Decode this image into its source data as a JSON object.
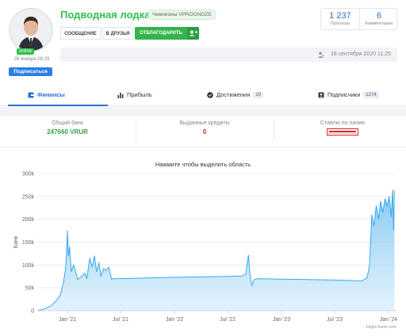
{
  "profile": {
    "name": "Подводная лодка",
    "badge": "Чемпионы VPROGNOZE",
    "status": "online",
    "joined": "28 января 08:29",
    "subscribe_label": "Подписаться"
  },
  "actions": {
    "message_label": "СООБЩЕНИЕ",
    "friend_label": "В ДРУЗЬЯ",
    "thank_label": "ОТБЛАГОДАРИТЬ"
  },
  "stats": {
    "forecasts_value": "1 237",
    "forecasts_label": "Прогнозы",
    "comments_value": "6",
    "comments_label": "Комментарии"
  },
  "last_visit": "18 сентября 2020 11:25",
  "tabs": [
    {
      "label": "Финансы",
      "icon": "wallet-icon",
      "active": true
    },
    {
      "label": "Прибыль",
      "icon": "bar-chart-icon"
    },
    {
      "label": "Достижения",
      "icon": "check-circle-icon",
      "count": "10"
    },
    {
      "label": "Подписчики",
      "icon": "user-card-icon",
      "count": "1274"
    }
  ],
  "finance": {
    "bank_label": "Общий банк",
    "bank_value": "247660 VRUR",
    "credits_label": "Выданные кредиты",
    "credits_value": "0",
    "line_label": "Ставлю по линии",
    "bookmaker_logo": "bookmaker-logo"
  },
  "colors": {
    "green": "#2fbf4d",
    "blue": "#2d6fd0",
    "red": "#e0231a",
    "area": "#7cc6f2"
  },
  "chart_data": {
    "type": "area",
    "title": "Нажмите чтобы выделить область",
    "ylabel": "Банк",
    "xlabel": "",
    "y_ticks": [
      "0",
      "50k",
      "100k",
      "150k",
      "200k",
      "250k",
      "300k"
    ],
    "x_ticks": [
      "Jan '21",
      "Jul '21",
      "Jan '22",
      "Jul '22",
      "Jan '23",
      "Jul '23",
      "Jan '24"
    ],
    "ylim": [
      0,
      300000
    ],
    "grid": true,
    "credits": "Highcharts.com",
    "points": [
      [
        "2020-09-20",
        0
      ],
      [
        "2020-10-15",
        4000
      ],
      [
        "2020-11-05",
        10000
      ],
      [
        "2020-11-25",
        22000
      ],
      [
        "2020-12-08",
        35000
      ],
      [
        "2020-12-18",
        60000
      ],
      [
        "2020-12-26",
        95000
      ],
      [
        "2020-12-30",
        140000
      ],
      [
        "2021-01-01",
        175000
      ],
      [
        "2021-01-04",
        120000
      ],
      [
        "2021-01-08",
        140000
      ],
      [
        "2021-01-14",
        85000
      ],
      [
        "2021-01-22",
        100000
      ],
      [
        "2021-02-05",
        68000
      ],
      [
        "2021-02-18",
        75000
      ],
      [
        "2021-03-01",
        82000
      ],
      [
        "2021-03-08",
        70000
      ],
      [
        "2021-03-18",
        115000
      ],
      [
        "2021-03-26",
        95000
      ],
      [
        "2021-04-03",
        120000
      ],
      [
        "2021-04-10",
        85000
      ],
      [
        "2021-04-18",
        105000
      ],
      [
        "2021-04-25",
        75000
      ],
      [
        "2021-05-05",
        92000
      ],
      [
        "2021-05-12",
        88000
      ],
      [
        "2021-05-22",
        95000
      ],
      [
        "2021-06-01",
        68000
      ],
      [
        "2021-06-05",
        70000
      ],
      [
        "2021-07-01",
        70000
      ],
      [
        "2022-01-01",
        73000
      ],
      [
        "2022-07-01",
        75000
      ],
      [
        "2022-08-20",
        76000
      ],
      [
        "2022-09-01",
        80000
      ],
      [
        "2022-09-10",
        122000
      ],
      [
        "2022-09-16",
        75000
      ],
      [
        "2022-09-22",
        55000
      ],
      [
        "2022-09-30",
        68000
      ],
      [
        "2022-10-15",
        70000
      ],
      [
        "2023-01-01",
        69000
      ],
      [
        "2023-07-01",
        67000
      ],
      [
        "2023-10-01",
        65000
      ],
      [
        "2023-10-20",
        72000
      ],
      [
        "2023-10-28",
        100000
      ],
      [
        "2023-11-05",
        210000
      ],
      [
        "2023-11-12",
        185000
      ],
      [
        "2023-11-20",
        230000
      ],
      [
        "2023-11-28",
        200000
      ],
      [
        "2023-12-05",
        240000
      ],
      [
        "2023-12-12",
        215000
      ],
      [
        "2023-12-20",
        245000
      ],
      [
        "2023-12-27",
        230000
      ],
      [
        "2024-01-03",
        250000
      ],
      [
        "2024-01-10",
        205000
      ],
      [
        "2024-01-15",
        265000
      ],
      [
        "2024-01-18",
        175000
      ],
      [
        "2024-01-21",
        262000
      ]
    ]
  }
}
